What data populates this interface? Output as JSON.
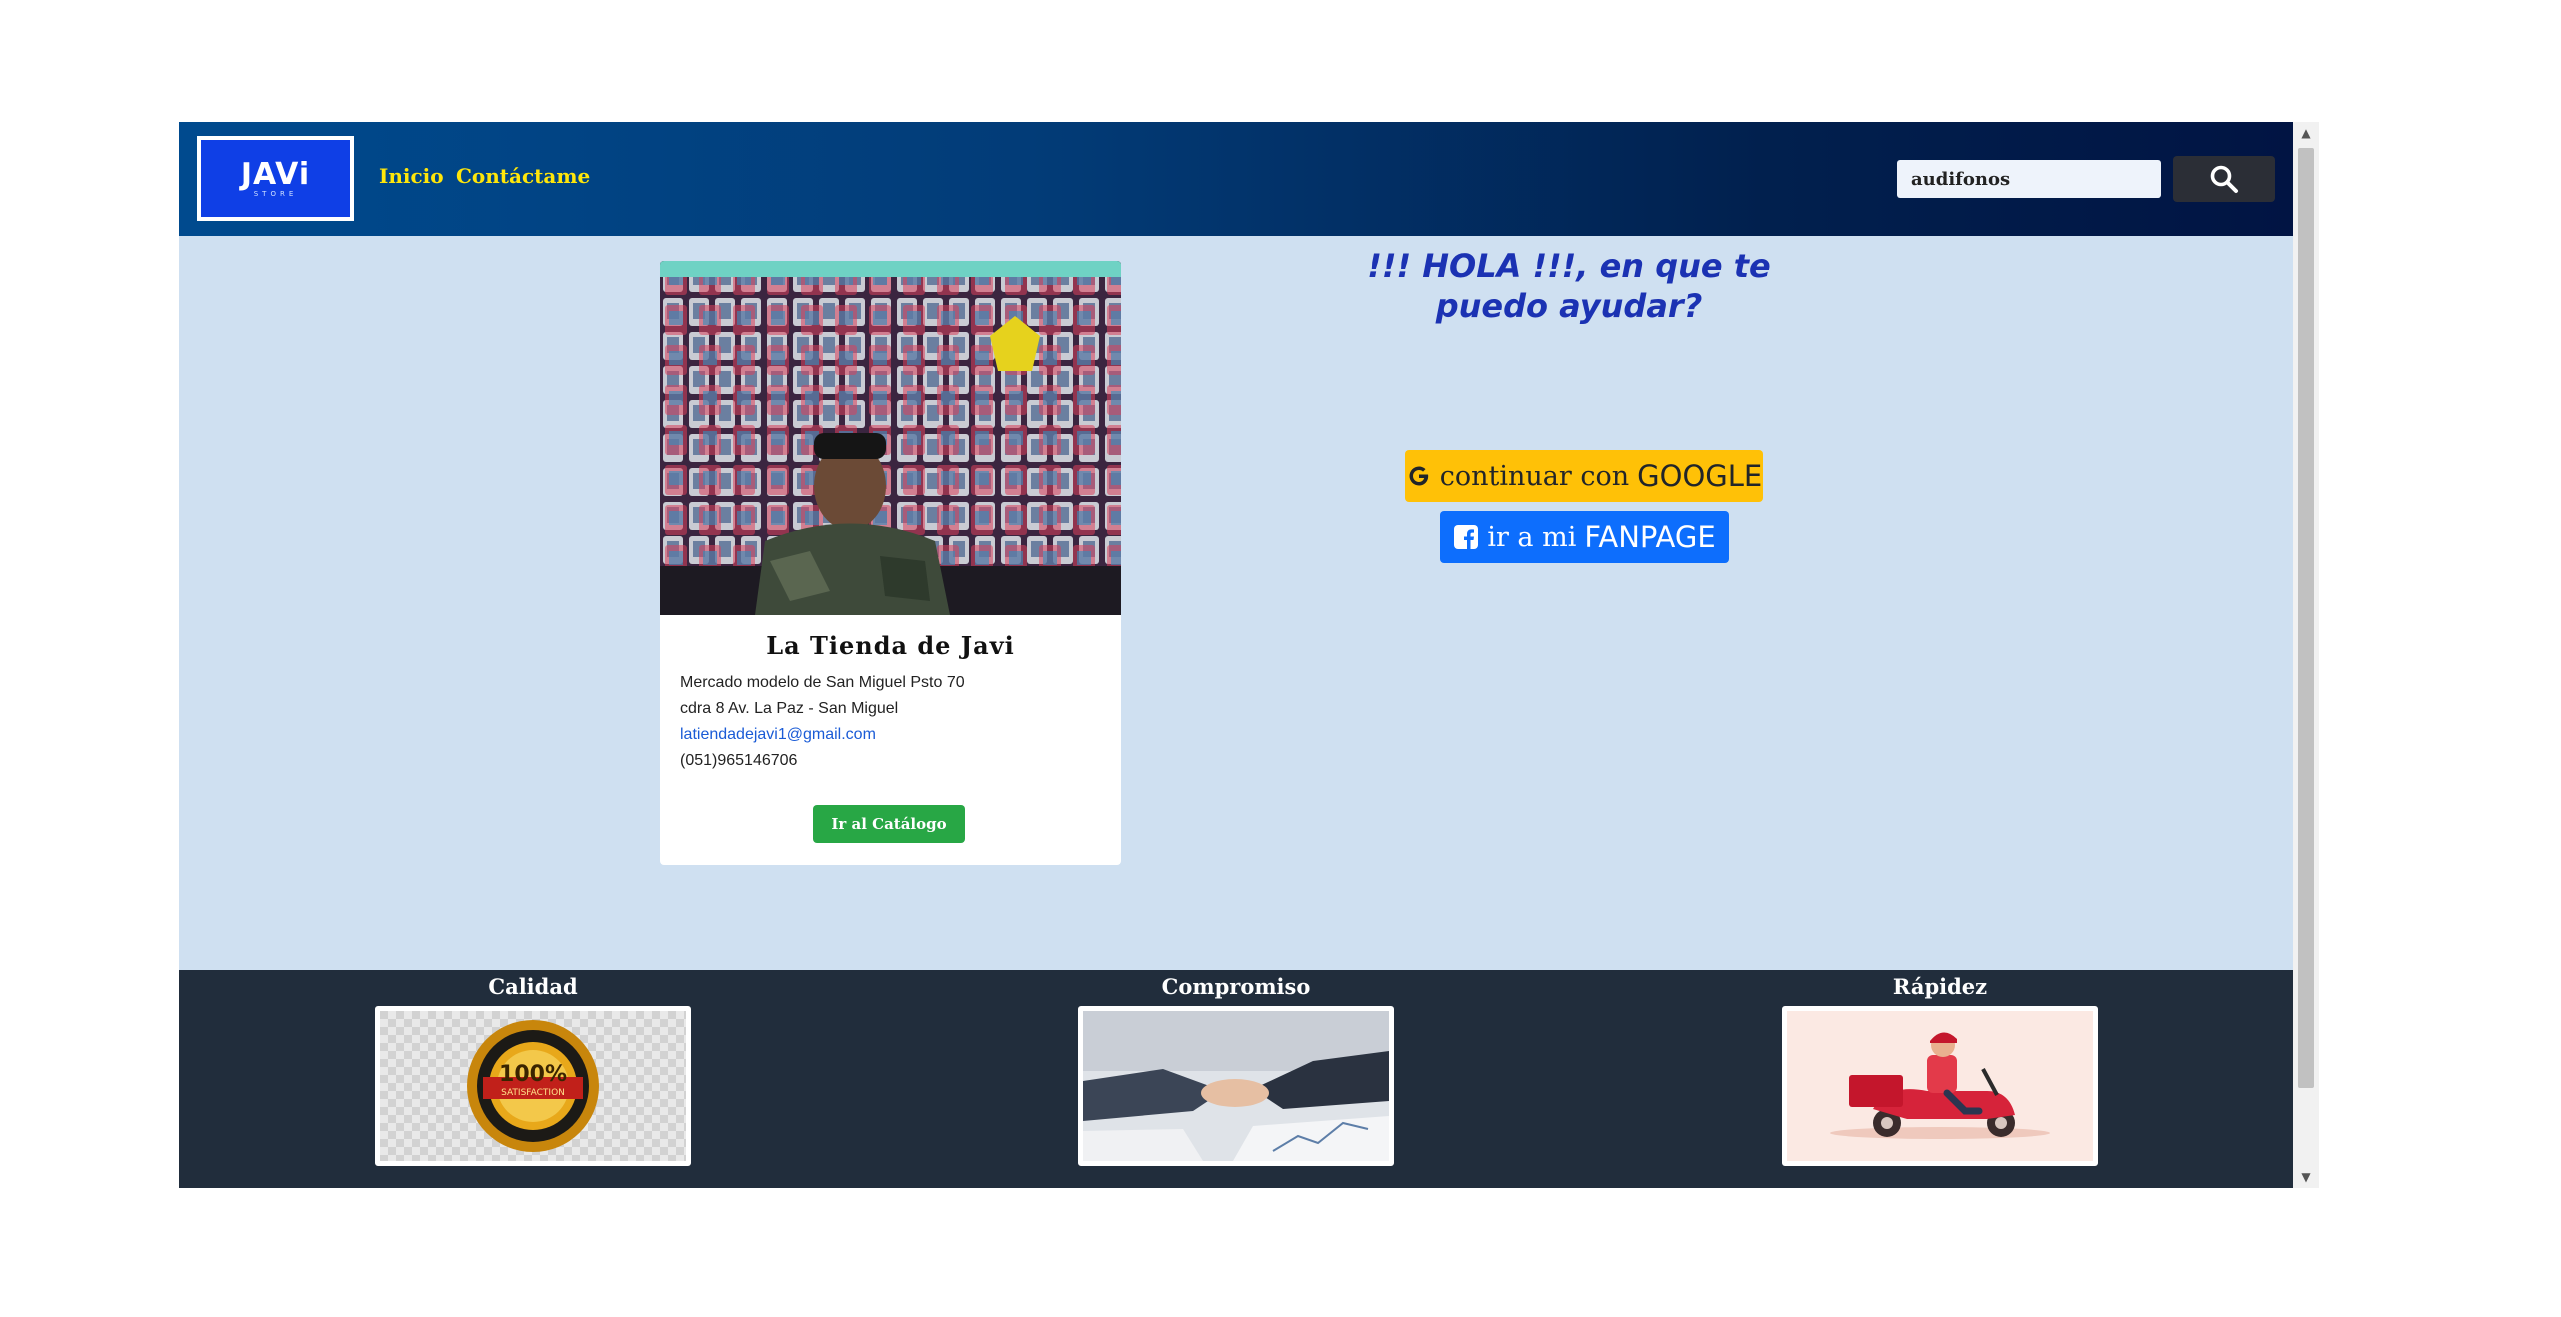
{
  "header": {
    "logo_text": "JAVi",
    "logo_subtext": "STORE",
    "nav": [
      "Inicio",
      "Contáctame"
    ],
    "search": {
      "value": "audifonos",
      "button_icon": "search-icon"
    }
  },
  "card": {
    "title": "La Tienda de Javi",
    "address_line1": "Mercado modelo de San Miguel Psto 70",
    "address_line2": "cdra 8 Av. La Paz - San Miguel",
    "email": "latiendadejavi1@gmail.com",
    "phone": "(051)965146706",
    "button": "Ir al Catálogo"
  },
  "hero": {
    "greeting": "!!! HOLA !!!, en que te puedo ayudar?",
    "google_prefix": "continuar con",
    "google_strong": "GOOGLE",
    "fanpage_prefix": "ir a mi",
    "fanpage_strong": "FANPAGE"
  },
  "footer": {
    "features": [
      {
        "title": "Calidad",
        "image_text": "100%",
        "image_subtext": "SATISFACTION"
      },
      {
        "title": "Compromiso"
      },
      {
        "title": "Rápidez"
      }
    ]
  },
  "colors": {
    "nav_link": "#ffe60a",
    "greeting": "#1b32b3",
    "google_button": "#ffc107",
    "fanpage_button": "#0d6efd",
    "catalog_button": "#28a745",
    "footer_bg": "#212d3c",
    "content_bg": "#cfe0f1"
  }
}
